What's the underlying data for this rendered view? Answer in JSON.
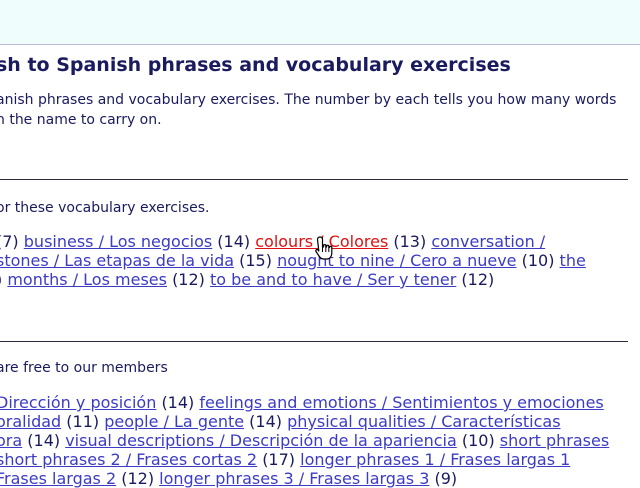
{
  "header": {
    "title": "sh to Spanish phrases and vocabulary exercises",
    "intro_line1": "anish phrases and vocabulary exercises. The number by each tells you how many words",
    "intro_line2": "n the name to carry on."
  },
  "section1": {
    "intro": "or these vocabulary exercises.",
    "rows": [
      [
        {
          "t": "count",
          "text": "(7)"
        },
        {
          "t": "link",
          "text": "business / Los negocios"
        },
        {
          "t": "count",
          "text": "(14)"
        },
        {
          "t": "link",
          "text": "colours / Colores",
          "hover": true
        },
        {
          "t": "count",
          "text": "(13)"
        },
        {
          "t": "link",
          "text": "conversation /"
        }
      ],
      [
        {
          "t": "link",
          "text": "stones / Las etapas de la vida"
        },
        {
          "t": "count",
          "text": "(15)"
        },
        {
          "t": "link",
          "text": "nought to nine / Cero a nueve"
        },
        {
          "t": "count",
          "text": "(10)"
        },
        {
          "t": "link",
          "text": "the"
        }
      ],
      [
        {
          "t": "count",
          "text": ")"
        },
        {
          "t": "link",
          "text": "months / Los meses"
        },
        {
          "t": "count",
          "text": "(12)"
        },
        {
          "t": "link",
          "text": "to be and to have / Ser y tener"
        },
        {
          "t": "count",
          "text": "(12)"
        }
      ]
    ]
  },
  "section2": {
    "intro": "are free to our members",
    "rows": [
      [
        {
          "t": "link",
          "text": "Dirección y posición"
        },
        {
          "t": "count",
          "text": "(14)"
        },
        {
          "t": "link",
          "text": "feelings and emotions / Sentimientos y emociones"
        }
      ],
      [
        {
          "t": "link",
          "text": "oralidad"
        },
        {
          "t": "count",
          "text": "(11)"
        },
        {
          "t": "link",
          "text": "people / La gente"
        },
        {
          "t": "count",
          "text": "(14)"
        },
        {
          "t": "link",
          "text": "physical qualities / Características"
        }
      ],
      [
        {
          "t": "link",
          "text": "ora"
        },
        {
          "t": "count",
          "text": "(14)"
        },
        {
          "t": "link",
          "text": "visual descriptions / Descripción de la apariencia"
        },
        {
          "t": "count",
          "text": "(10)"
        },
        {
          "t": "link",
          "text": "short phrases"
        }
      ],
      [
        {
          "t": "link",
          "text": "short phrases 2 / Frases cortas 2"
        },
        {
          "t": "count",
          "text": "(17)"
        },
        {
          "t": "link",
          "text": "longer phrases 1 / Frases largas 1"
        }
      ],
      [
        {
          "t": "link",
          "text": "Frases largas 2"
        },
        {
          "t": "count",
          "text": "(12)"
        },
        {
          "t": "link",
          "text": "longer phrases 3 / Frases largas 3"
        },
        {
          "t": "count",
          "text": "(9)"
        }
      ]
    ]
  },
  "cursor": {
    "icon": "hand-pointer-icon"
  }
}
